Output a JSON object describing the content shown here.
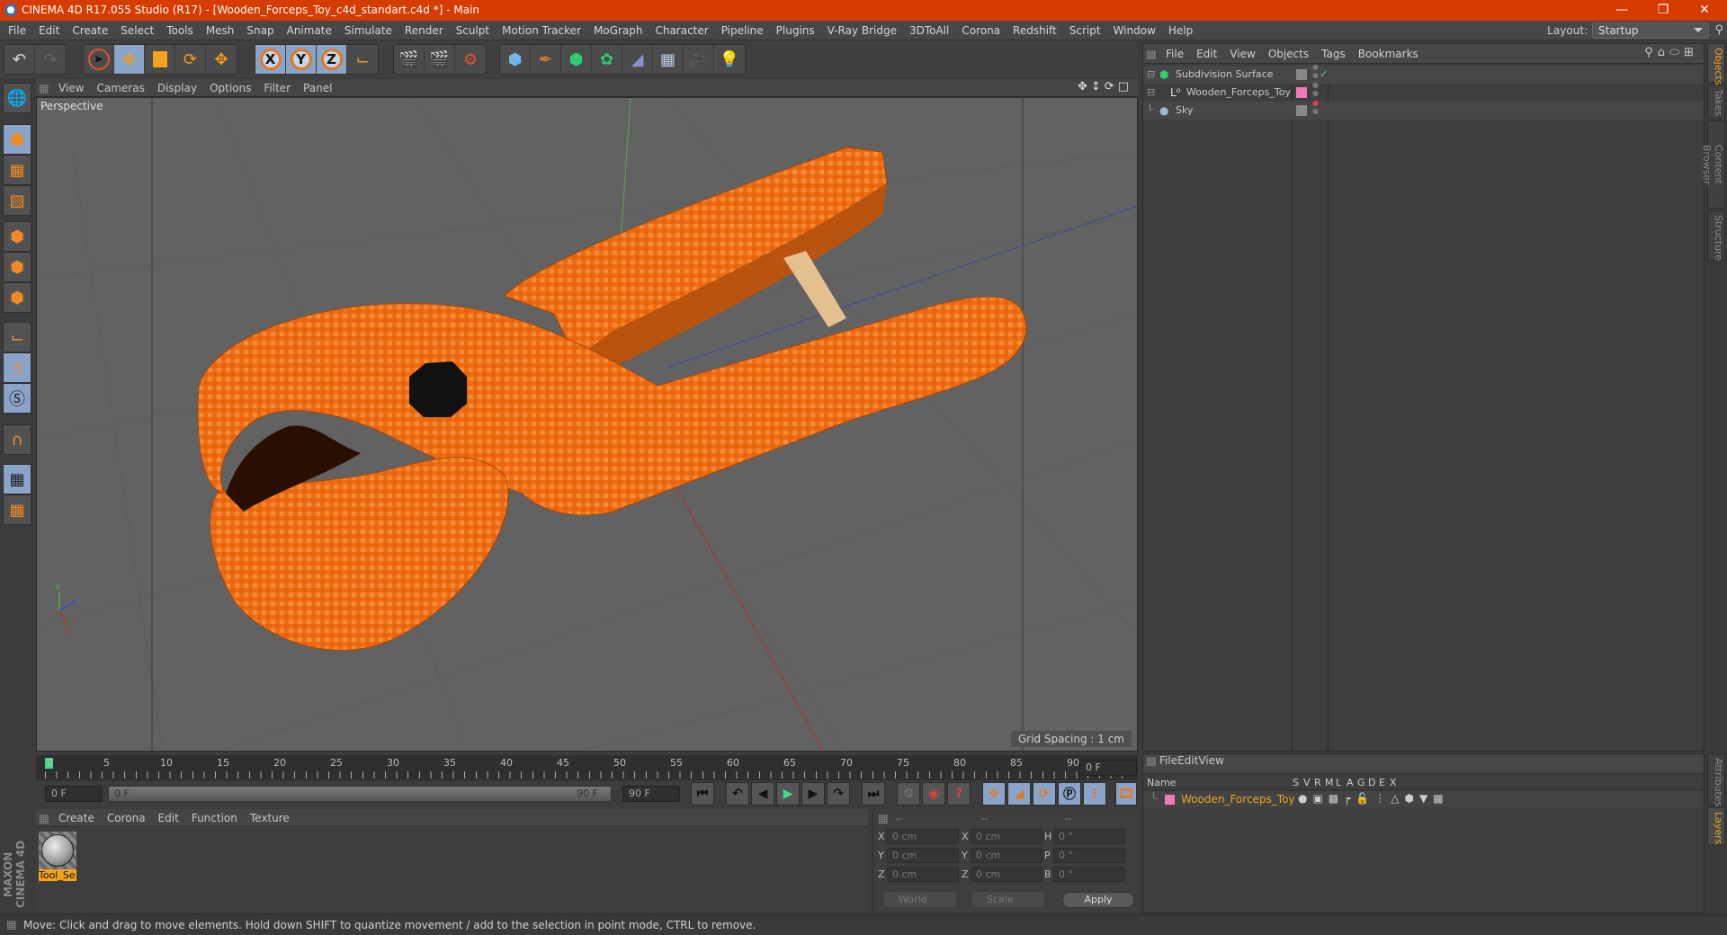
{
  "window": {
    "title": "CINEMA 4D R17.055 Studio (R17) - [Wooden_Forceps_Toy_c4d_standart.c4d *] - Main",
    "controls": [
      "minimize",
      "restore",
      "close"
    ],
    "accent_color": "#d63b00"
  },
  "menubar": {
    "items": [
      "File",
      "Edit",
      "Create",
      "Select",
      "Tools",
      "Mesh",
      "Snap",
      "Animate",
      "Simulate",
      "Render",
      "Sculpt",
      "Motion Tracker",
      "MoGraph",
      "Character",
      "Pipeline",
      "Plugins",
      "V-Ray Bridge",
      "3DToAll",
      "Corona",
      "Redshift",
      "Script",
      "Window",
      "Help"
    ],
    "layout_label": "Layout:",
    "layout_value": "Startup"
  },
  "toolbar": {
    "groups": [
      [
        "undo-icon",
        "redo-icon"
      ],
      [
        "live-selection-icon",
        "move-icon",
        "scale-icon",
        "rotate-icon",
        "recent-tool-icon"
      ],
      [
        "x-axis-lock-icon",
        "y-axis-lock-icon",
        "z-axis-lock-icon",
        "coordinate-system-icon"
      ],
      [
        "render-view-icon",
        "render-to-picture-viewer-icon",
        "render-settings-icon"
      ],
      [
        "cube-icon",
        "pen-spline-icon",
        "subdivision-surface-icon",
        "mograph-cloner-icon",
        "deformer-icon",
        "floor-icon",
        "camera-icon",
        "light-icon"
      ]
    ],
    "axis_labels": [
      "X",
      "Y",
      "Z"
    ]
  },
  "left_tools": [
    "make-editable-icon",
    "model-mode-icon",
    "texture-mode-icon",
    "workplane-mode-icon",
    "points-mode-icon",
    "edges-mode-icon",
    "polygons-mode-icon",
    "axis-mode-icon",
    "tweak-mode-icon",
    "solo-mode-icon",
    "snap-icon",
    "workplane-lock-icon",
    "workplane-align-icon"
  ],
  "viewport": {
    "menu": [
      "View",
      "Cameras",
      "Display",
      "Options",
      "Filter",
      "Panel"
    ],
    "label": "Perspective",
    "grid_spacing": "Grid Spacing : 1 cm",
    "axis_labels": [
      "Y",
      "Z",
      "X"
    ],
    "nav_icons": [
      "pan-icon",
      "dolly-icon",
      "orbit-icon",
      "maximize-view-icon"
    ]
  },
  "timeline": {
    "ticks": [
      "0",
      "5",
      "10",
      "15",
      "20",
      "25",
      "30",
      "35",
      "40",
      "45",
      "50",
      "55",
      "60",
      "65",
      "70",
      "75",
      "80",
      "85",
      "90"
    ],
    "current_frame": "0 F",
    "start_field": "0 F",
    "range_start": "0 F",
    "range_end": "90 F",
    "end_field": "90 F"
  },
  "transport": [
    "go-to-start-icon",
    "previous-key-icon",
    "previous-frame-icon",
    "play-icon",
    "next-frame-icon",
    "next-key-icon",
    "go-to-end-icon"
  ],
  "record_tools": [
    "motion-clip-icon",
    "autokey-icon",
    "keyframe-help-icon"
  ],
  "key_tools": [
    "key-position-icon",
    "key-scale-icon",
    "key-rotation-icon",
    "key-parameter-icon",
    "key-pla-icon",
    "timeline-window-icon"
  ],
  "material_manager": {
    "menu": [
      "Create",
      "Corona",
      "Edit",
      "Function",
      "Texture"
    ],
    "materials": [
      {
        "name": "Tool_Se"
      }
    ]
  },
  "branding": "MAXON CINEMA 4D",
  "coordinates": {
    "headers": [
      "--",
      "--",
      "--"
    ],
    "rows": [
      {
        "l1": "X",
        "v1": "0 cm",
        "l2": "X",
        "v2": "0 cm",
        "l3": "H",
        "v3": "0 °"
      },
      {
        "l1": "Y",
        "v1": "0 cm",
        "l2": "Y",
        "v2": "0 cm",
        "l3": "P",
        "v3": "0 °"
      },
      {
        "l1": "Z",
        "v1": "0 cm",
        "l2": "Z",
        "v2": "0 cm",
        "l3": "B",
        "v3": "0 °"
      }
    ],
    "space": "World",
    "mode": "Scale",
    "apply": "Apply"
  },
  "object_manager": {
    "menu": [
      "File",
      "Edit",
      "View",
      "Objects",
      "Tags",
      "Bookmarks"
    ],
    "objects": [
      {
        "name": "Subdivision Surface",
        "icon": "subdivision-surface-icon",
        "tag_color": "#888888",
        "status": "enabled-check"
      },
      {
        "name": "Wooden_Forceps_Toy",
        "icon": "null-object-icon",
        "tag_color": "#f07ab8",
        "status": "default"
      },
      {
        "name": "Sky",
        "icon": "sky-icon",
        "tag_color": "#888888",
        "status": "render-off"
      }
    ]
  },
  "layer_manager": {
    "menu": [
      "File",
      "Edit",
      "View"
    ],
    "columns": [
      "Name",
      "S",
      "V",
      "R",
      "M",
      "L",
      "A",
      "G",
      "D",
      "E",
      "X"
    ],
    "layers": [
      {
        "name": "Wooden_Forceps_Toy",
        "color": "#f07ab8"
      }
    ]
  },
  "side_tabs": {
    "top": [
      "Objects",
      "Takes",
      "Content Browser",
      "Structure"
    ],
    "bottom": [
      "Attributes",
      "Layers"
    ]
  },
  "status_bar": "Move: Click and drag to move elements. Hold down SHIFT to quantize movement / add to the selection in point mode, CTRL to remove."
}
